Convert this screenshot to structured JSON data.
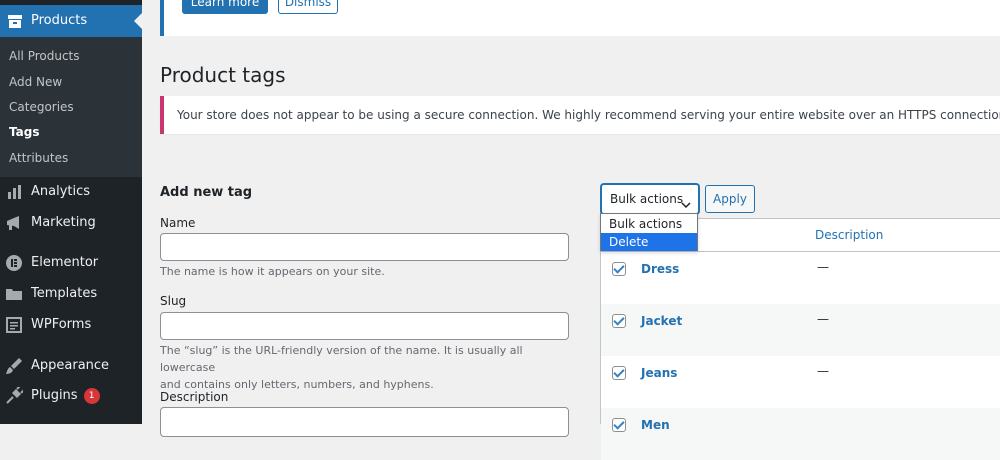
{
  "sidebar": {
    "current": {
      "label": "Products",
      "icon": "products-box-icon"
    },
    "submenu": [
      {
        "label": "All Products",
        "current": false
      },
      {
        "label": "Add New",
        "current": false
      },
      {
        "label": "Categories",
        "current": false
      },
      {
        "label": "Tags",
        "current": true
      },
      {
        "label": "Attributes",
        "current": false
      }
    ],
    "items": [
      {
        "label": "Analytics",
        "icon": "bar-chart-icon"
      },
      {
        "label": "Marketing",
        "icon": "megaphone-icon"
      },
      {
        "label": "Elementor",
        "icon": "elementor-icon"
      },
      {
        "label": "Templates",
        "icon": "folder-icon"
      },
      {
        "label": "WPForms",
        "icon": "form-icon"
      },
      {
        "label": "Appearance",
        "icon": "paintbrush-icon"
      },
      {
        "label": "Plugins",
        "icon": "plug-icon",
        "badge": "1"
      }
    ]
  },
  "notice_top": {
    "primary_label": "Learn more",
    "secondary_label": "Dismiss"
  },
  "page": {
    "title": "Product tags",
    "ssl_notice": "Your store does not appear to be using a secure connection. We highly recommend serving your entire website over an HTTPS connection to help keep customer data secure."
  },
  "form": {
    "heading": "Add new tag",
    "name_label": "Name",
    "name_value": "",
    "name_help": "The name is how it appears on your site.",
    "slug_label": "Slug",
    "slug_value": "",
    "slug_help_1": "The “slug” is the URL-friendly version of the name. It is usually all lowercase",
    "slug_help_2": "and contains only letters, numbers, and hyphens.",
    "description_label": "Description"
  },
  "bulk": {
    "selected": "Bulk actions",
    "apply": "Apply",
    "options": [
      "Bulk actions",
      "Delete"
    ],
    "highlighted": "Delete"
  },
  "table": {
    "col_description": "Description",
    "rows": [
      {
        "name": "Dress",
        "description": "—",
        "checked": true
      },
      {
        "name": "Jacket",
        "description": "—",
        "checked": true
      },
      {
        "name": "Jeans",
        "description": "—",
        "checked": true
      },
      {
        "name": "Men",
        "description": "",
        "checked": true
      }
    ]
  },
  "colors": {
    "sidebar_bg": "#1d2327",
    "accent": "#2271b1",
    "notice_border": "#c9356e",
    "badge": "#d63638",
    "dropdown_highlight": "#1e73e8"
  }
}
